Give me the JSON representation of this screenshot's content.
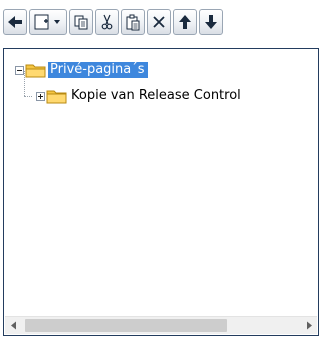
{
  "toolbar": {
    "buttons": [
      {
        "name": "back-button",
        "icon": "arrow-left-icon"
      },
      {
        "name": "new-button",
        "icon": "new-page-icon",
        "has_dropdown": true
      },
      {
        "name": "copy-button",
        "icon": "copy-icon"
      },
      {
        "name": "cut-button",
        "icon": "scissors-icon"
      },
      {
        "name": "paste-button",
        "icon": "paste-icon"
      },
      {
        "name": "delete-button",
        "icon": "close-icon"
      },
      {
        "name": "move-up-button",
        "icon": "arrow-up-icon"
      },
      {
        "name": "move-down-button",
        "icon": "arrow-down-icon"
      }
    ]
  },
  "tree": {
    "root": {
      "label": "Privé-pagina´s",
      "expanded": true,
      "selected": true
    },
    "children": [
      {
        "label": "Kopie van Release Control",
        "expanded": false
      }
    ]
  },
  "colors": {
    "selection": "#3e87dd",
    "panel_border": "#233c5e",
    "folder": "#f5c542"
  }
}
